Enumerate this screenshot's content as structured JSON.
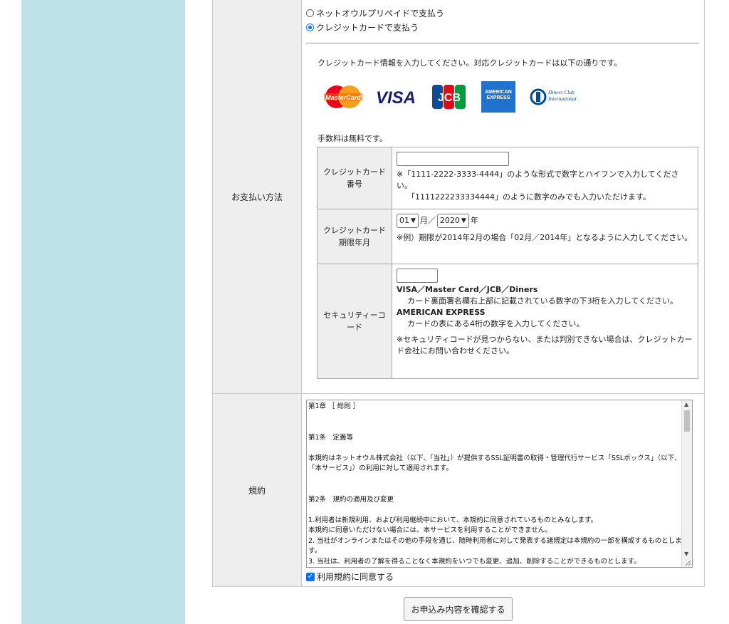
{
  "payment": {
    "label": "お支払い方法",
    "options": [
      {
        "label": "ネットオウルプリペイドで支払う",
        "selected": false
      },
      {
        "label": "クレジットカードで支払う",
        "selected": true
      }
    ],
    "intro": "クレジットカード情報を入力してください。対応クレジットカードは以下の通りです。",
    "card_logos": [
      {
        "name": "mastercard-logo",
        "text": "MasterCard"
      },
      {
        "name": "visa-logo",
        "text": "VISA"
      },
      {
        "name": "jcb-logo",
        "text": "JCB"
      },
      {
        "name": "amex-logo",
        "text": "AMERICAN EXPRESS"
      },
      {
        "name": "diners-logo",
        "text": "Diners Club International"
      }
    ],
    "fee": "手数料は無料です。",
    "card_number": {
      "label": "クレジットカード番号",
      "value": "",
      "note1": "※「1111-2222-3333-4444」のような形式で数字とハイフンで入力してください。",
      "note2": "「1111222233334444」のように数字のみでも入力いただけます。"
    },
    "expiry": {
      "label": "クレジットカード期限年月",
      "month": "01",
      "month_unit": "月／",
      "year": "2020",
      "year_unit": "年",
      "note": "※例）期限が2014年2月の場合「02月／2014年」となるように入力してください。"
    },
    "security": {
      "label": "セキュリティーコード",
      "value": "",
      "brands1": "VISA／Master Card／JCB／Diners",
      "desc1": "カード裏面署名欄右上部に記載されている数字の下3桁を入力してください。",
      "brands2": "AMERICAN EXPRESS",
      "desc2": "カードの表にある4桁の数字を入力してください。",
      "note": "※セキュリティコードが見つからない、または判別できない場合は、クレジットカード会社にお問い合わせください。"
    }
  },
  "terms": {
    "label": "規約",
    "text": "第1章 ［ 総則 ］\n\n\n第1条　定義等\n\n本規約はネットオウル株式会社（以下、「当社」）が提供するSSL証明書の取得・管理代行サービス「SSLボックス」（以下、「本サービス」）の利用に対して適用されます。\n\n\n第2条　規約の適用及び変更\n\n1.利用者は新規利用、および利用継続中において、本規約に同意されているものとみなします。\n本規約に同意いただけない場合には、本サービスを利用することができません。\n2. 当社がオンラインまたはその他の手段を通じ、随時利用者に対して発表する諸規定は本規約の一部を構成するものとします。\n3. 当社は、利用者の了解を得ることなく本規約をいつでも変更、追加、削除することができるものとします。",
    "agree_label": "利用規約に同意する",
    "agreed": true
  },
  "confirm_button": "お申込み内容を確認する"
}
